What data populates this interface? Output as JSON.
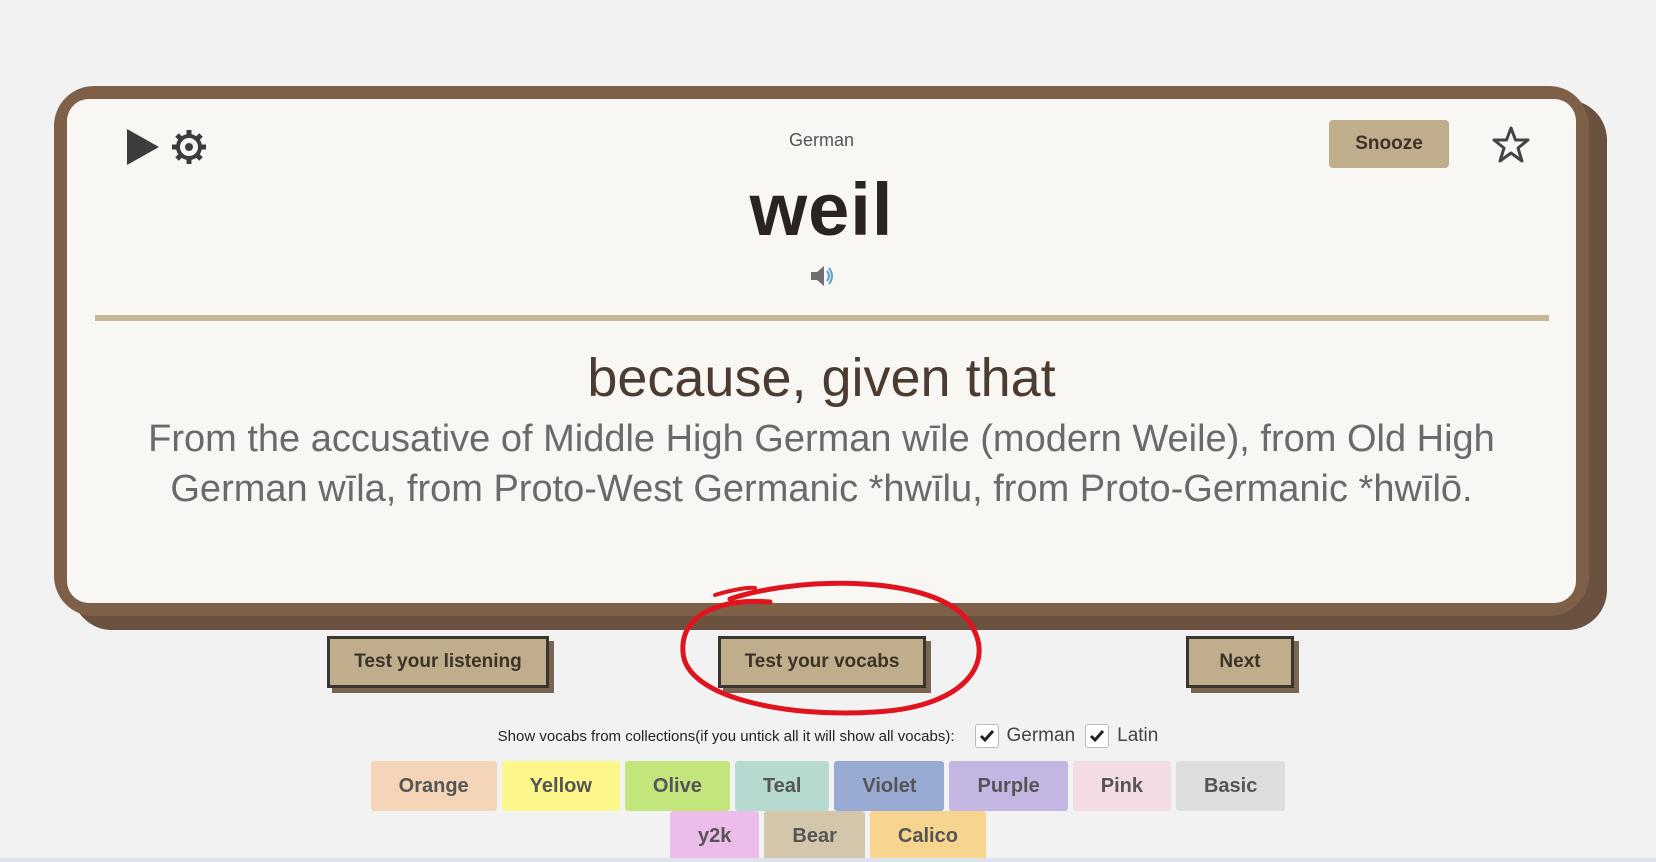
{
  "card": {
    "language": "German",
    "word": "weil",
    "meaning": "because, given that",
    "etymology": "From the accusative of Middle High German wīle (modern Weile), from Old High German wīla, from Proto-West Germanic *hwīlu, from Proto-Germanic *hwīlō.",
    "snooze_label": "Snooze"
  },
  "actions": {
    "listening_label": "Test your listening",
    "vocabs_label": "Test your vocabs",
    "next_label": "Next"
  },
  "filter": {
    "text": "Show vocabs from collections(if you untick all it will show all vocabs):",
    "collections": [
      {
        "label": "German",
        "checked": true
      },
      {
        "label": "Latin",
        "checked": true
      }
    ]
  },
  "themes": [
    {
      "label": "Orange",
      "color": "#f5d5b8"
    },
    {
      "label": "Yellow",
      "color": "#fdf68a"
    },
    {
      "label": "Olive",
      "color": "#c2e57c"
    },
    {
      "label": "Teal",
      "color": "#b6dad0"
    },
    {
      "label": "Violet",
      "color": "#99aad3"
    },
    {
      "label": "Purple",
      "color": "#c4b6e2"
    },
    {
      "label": "Pink",
      "color": "#f3dce3"
    },
    {
      "label": "Basic",
      "color": "#dedede"
    },
    {
      "label": "y2k",
      "color": "#ecbdea"
    },
    {
      "label": "Bear",
      "color": "#d4c6aa"
    },
    {
      "label": "Calico",
      "color": "#f8d58e"
    }
  ],
  "colors": {
    "card_border": "#7e6049",
    "card_bg": "#f9f7f4",
    "button_bg": "#bfad8b",
    "annotation": "#e0141e"
  }
}
